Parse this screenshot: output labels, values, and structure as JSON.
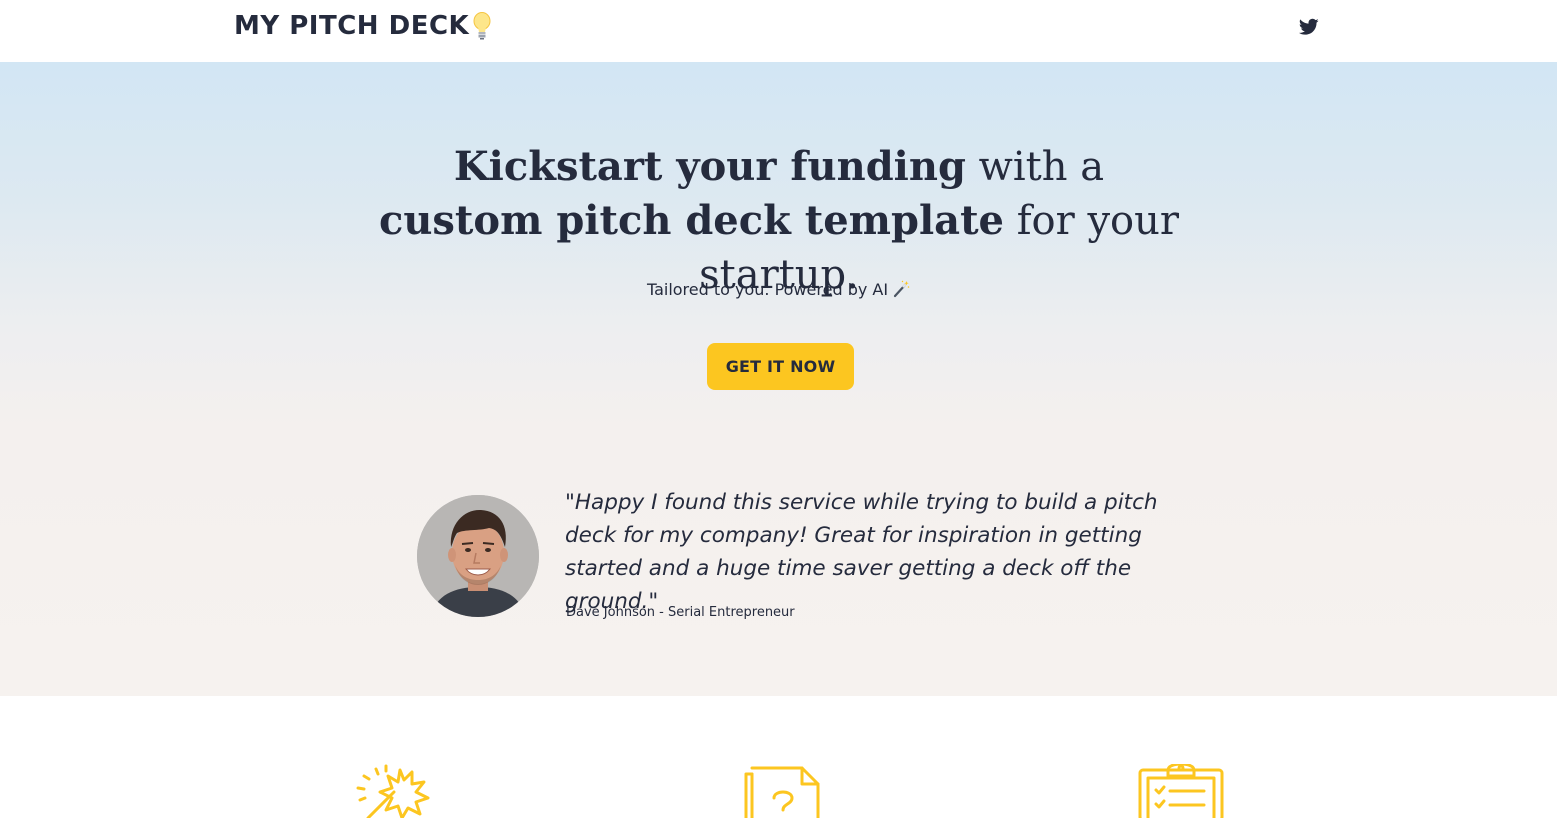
{
  "navbar": {
    "brand": "MY PITCH DECK",
    "brand_icon": "lightbulb-icon",
    "social_icon": "twitter-icon"
  },
  "hero": {
    "headline": {
      "part1": "Kickstart your funding",
      "part2": " with a ",
      "part3": "custom pitch deck template",
      "part4": " for your startup."
    },
    "subtitle": "Tailored to you. Powered by AI",
    "subtitle_icon": "magic-wand-icon",
    "cta_label": "GET IT NOW"
  },
  "testimonial": {
    "quote": "\"Happy I found this service while trying to build a pitch deck for my company! Great for inspiration in getting started and a huge time saver getting a deck off the ground.\"",
    "author": "Dave Johnson - Serial Entrepreneur",
    "avatar_icon": "person-avatar"
  },
  "features": {
    "icons": [
      "magic-burst-icon",
      "question-document-icon",
      "clipboard-checklist-icon"
    ]
  },
  "colors": {
    "accent": "#fcc620",
    "text": "#252b3d",
    "hero_top": "#d2e6f4",
    "hero_bottom": "#f6f2ef"
  }
}
